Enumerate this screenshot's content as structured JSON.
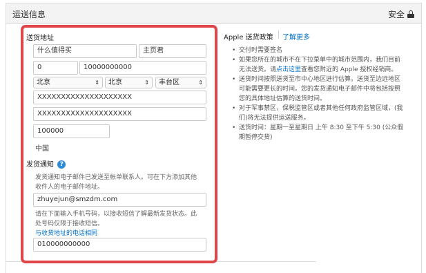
{
  "header": {
    "title": "运送信息",
    "secure_label": "安全"
  },
  "shipping_address": {
    "label": "送货地址",
    "first_name": "什么值得买",
    "last_name": "主页君",
    "area_code": "0",
    "phone": "10000000000",
    "province": "北京",
    "city": "北京",
    "district": "丰台区",
    "address_line1": "XXXXXXXXXXXXXXXXXXXX",
    "address_line2": "XXXXXXXXXXXXXXXXXXXX",
    "postal_code": "100000",
    "country": "中国"
  },
  "shipping_notice": {
    "label": "发货通知",
    "help_icon": "?",
    "email_note": "发货通知电子邮件已发送至帐单联系人。可在下方添加其他收件人的电子邮件地址。",
    "email_line1": "发货通知电子邮件已发送至帐单联系人。可在下方添加其他",
    "email_line2": "收件人的电子邮件地址。",
    "email": "zhuyejun@smzdm.com",
    "sms_line1": "请在下面输入手机号码，以接收短信了解最新发货状态。此",
    "sms_line2": "处号码仅限于接收短信。",
    "same_phone_link": "与收货地址的电话相同",
    "mobile": "010000000000"
  },
  "policy": {
    "title": "Apple 送货政策",
    "learn_more": "了解更多",
    "items": [
      {
        "lines": [
          "交付时需要签名"
        ]
      },
      {
        "lines": [
          "如果您所在的城市不在下拉菜单中的城市范围内，我们目前",
          "无法送货。请"
        ],
        "link": "点击这里",
        "after": "查看您附近的 Apple 授权经销商。"
      },
      {
        "lines": [
          "送货时间按照送货至市中心地区进行估算。送货至边远地区",
          "可能需要更长的时间。您的发货通知电子邮件中将包括按照",
          "您的具体地址估算的送货时间。"
        ]
      },
      {
        "lines": [
          "对于军事禁区，保税监管区或者其他任何政府监管区域，(我",
          "们)将无法提供运送服务。"
        ]
      },
      {
        "lines": [
          "送货时间：星期一至星期日 上午 8:30 至下午 5:30 (公众假",
          "期暂停交货)"
        ]
      }
    ]
  },
  "colors": {
    "highlight_border": "#e0454a",
    "link": "#0070c9",
    "help_icon": "#2d8bd8"
  }
}
